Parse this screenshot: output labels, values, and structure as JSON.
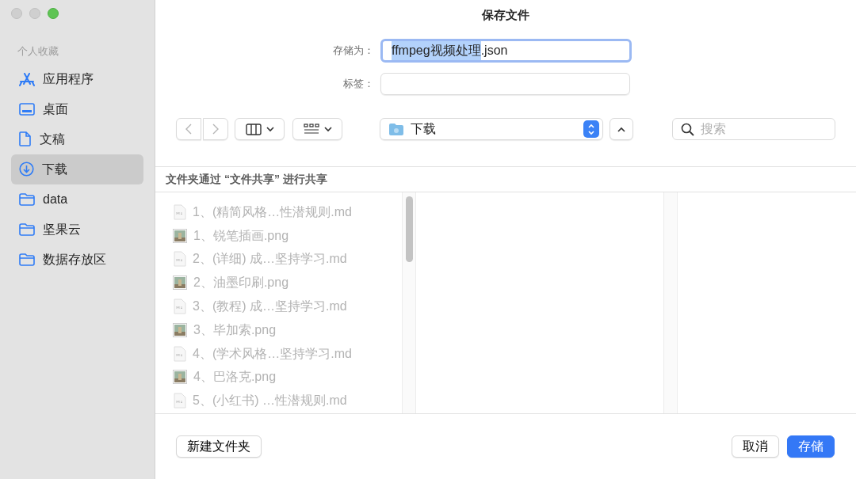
{
  "window": {
    "title": "保存文件",
    "controls": [
      {
        "active": false
      },
      {
        "active": false
      },
      {
        "active": true
      }
    ]
  },
  "sidebar": {
    "heading": "个人收藏",
    "items": [
      {
        "label": "应用程序",
        "selected": false
      },
      {
        "label": "桌面",
        "selected": false
      },
      {
        "label": "文稿",
        "selected": false
      },
      {
        "label": "下载",
        "selected": true
      },
      {
        "label": "data",
        "selected": false
      },
      {
        "label": "坚果云",
        "selected": false
      },
      {
        "label": "数据存放区",
        "selected": false
      }
    ]
  },
  "save_as": {
    "label": "存储为：",
    "value_selected": "ffmpeg视频处理",
    "value_rest": ".json"
  },
  "tags": {
    "label": "标签："
  },
  "location": {
    "label": "下载"
  },
  "search": {
    "placeholder": "搜索"
  },
  "shared_notice": "文件夹通过 “文件共享” 进行共享",
  "files": [
    {
      "kind": "md",
      "name": "1、(精简风格…性潜规则.md",
      "disabled": true
    },
    {
      "kind": "png",
      "name": "1、锐笔插画.png",
      "disabled": true
    },
    {
      "kind": "md",
      "name": "2、(详细) 成…坚持学习.md",
      "disabled": true
    },
    {
      "kind": "png",
      "name": "2、油墨印刷.png",
      "disabled": true
    },
    {
      "kind": "md",
      "name": "3、(教程) 成…坚持学习.md",
      "disabled": true
    },
    {
      "kind": "png",
      "name": "3、毕加索.png",
      "disabled": true
    },
    {
      "kind": "md",
      "name": "4、(学术风格…坚持学习.md",
      "disabled": true
    },
    {
      "kind": "png",
      "name": "4、巴洛克.png",
      "disabled": true
    },
    {
      "kind": "md",
      "name": "5、(小红书) …性潜规则.md",
      "disabled": true
    }
  ],
  "buttons": [
    {
      "kind": "secondary",
      "label": "新建文件夹"
    },
    {
      "kind": "secondary",
      "label": "取消"
    },
    {
      "kind": "primary",
      "label": "存储"
    }
  ]
}
